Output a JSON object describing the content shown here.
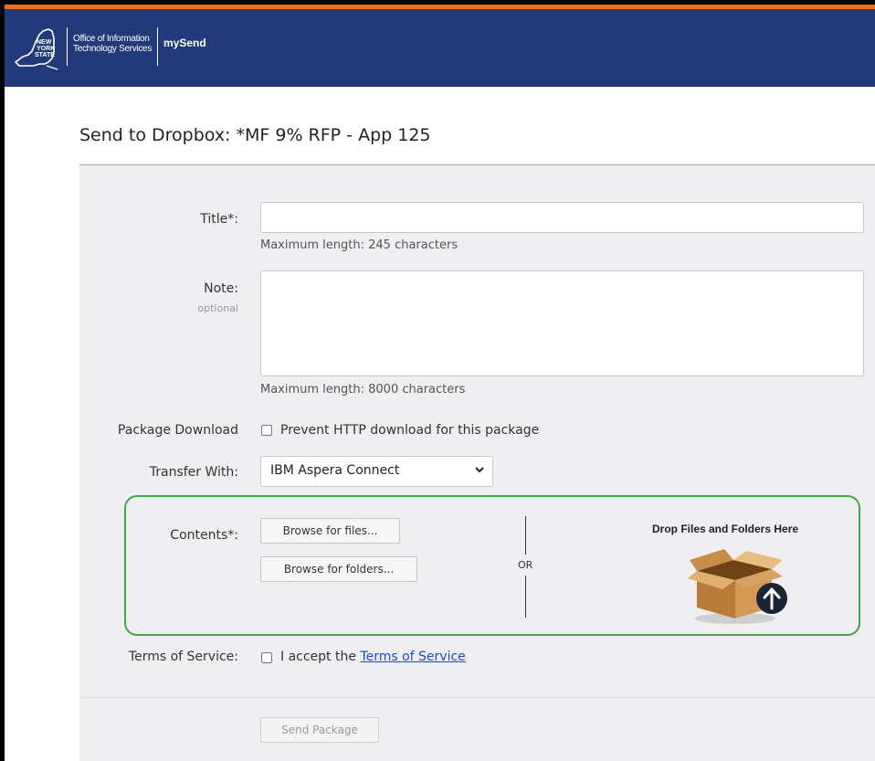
{
  "header": {
    "logo_lines": [
      "NEW",
      "YORK",
      "STATE"
    ],
    "org_line1": "Office of Information",
    "org_line2": "Technology Services",
    "app_name": "mySend"
  },
  "page": {
    "title": "Send to Dropbox: *MF 9% RFP - App 125"
  },
  "form": {
    "title_label": "Title*:",
    "title_value": "",
    "title_hint": "Maximum length: 245 characters",
    "note_label": "Note:",
    "note_sublabel": "optional",
    "note_value": "",
    "note_hint": "Maximum length: 8000 characters",
    "package_download_label": "Package Download",
    "prevent_http_label": "Prevent HTTP download for this package",
    "prevent_http_checked": false,
    "transfer_label": "Transfer With:",
    "transfer_selected": "IBM Aspera Connect",
    "contents_label": "Contents*:",
    "browse_files_label": "Browse for files...",
    "browse_folders_label": "Browse for folders...",
    "or_label": "OR",
    "drop_label": "Drop Files and Folders Here",
    "terms_label": "Terms of Service:",
    "terms_prefix": "I accept the",
    "terms_link": "Terms of Service",
    "terms_checked": false,
    "send_label": "Send Package"
  },
  "colors": {
    "header_bg": "#233a7a",
    "header_accent": "#e8731a",
    "contents_border": "#3ea84a",
    "link": "#1a4bd6"
  }
}
